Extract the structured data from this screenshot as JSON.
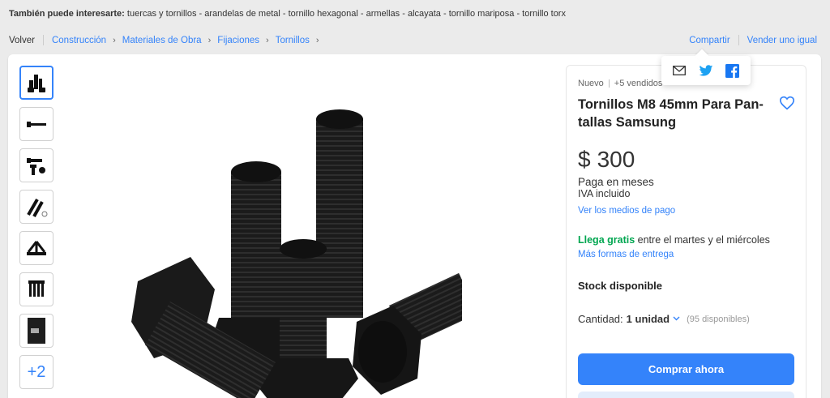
{
  "interest": {
    "label": "También puede interesarte:",
    "keywords": "tuercas y tornillos - arandelas de metal - tornillo hexagonal - armellas - alcayata - tornillo mariposa - tornillo torx"
  },
  "breadcrumb": {
    "back": "Volver",
    "items": [
      "Construcción",
      "Materiales de Obra",
      "Fijaciones",
      "Tornillos"
    ]
  },
  "actions": {
    "share": "Compartir",
    "sell": "Vender uno igual"
  },
  "share_menu": {
    "icons": [
      "mail-icon",
      "twitter-icon",
      "facebook-icon"
    ]
  },
  "gallery": {
    "thumbnails": [
      "bolts-group",
      "single-bolt",
      "bolts-pair",
      "bolts-with-washer",
      "bolts-fan",
      "bolts-row",
      "package-photo"
    ],
    "more_label": "+2"
  },
  "product": {
    "condition": "Nuevo",
    "sold": "+5 vendidos",
    "title": "Tornillos M8 45mm Para Pan-tallas Samsung",
    "currency": "$",
    "price": "300",
    "installments": "Paga en meses",
    "tax": "IVA incluido",
    "payment_link": "Ver los medios de pago",
    "shipping_highlight": "Llega gratis",
    "shipping_rest": "entre el martes y el miércoles",
    "shipping_link": "Más formas de entrega",
    "stock": "Stock disponible",
    "quantity_label": "Cantidad:",
    "quantity_value": "1 unidad",
    "available": "(95 disponibles)",
    "buy_label": "Comprar ahora"
  },
  "colors": {
    "accent": "#3483fa",
    "green": "#00a650",
    "background": "#ebebeb"
  }
}
